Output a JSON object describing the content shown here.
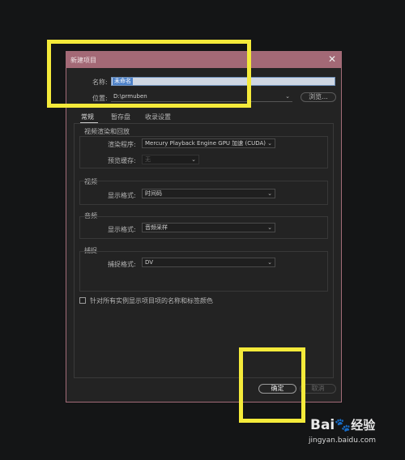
{
  "dialog": {
    "title": "新建项目",
    "close_glyph": "✕",
    "name_label": "名称:",
    "name_value": "未命名",
    "location_label": "位置:",
    "location_value": "D:\\prmuben",
    "browse_label": "浏览...",
    "tabs": [
      {
        "label": "常规",
        "active": true
      },
      {
        "label": "暂存盘",
        "active": false
      },
      {
        "label": "收录设置",
        "active": false
      }
    ],
    "video_rendering": {
      "heading": "视频渲染和回放",
      "renderer_label": "渲染程序:",
      "renderer_value": "Mercury Playback Engine GPU 加速 (CUDA)",
      "preview_cache_label": "预览缓存:",
      "preview_cache_value": "无"
    },
    "video": {
      "heading": "视频",
      "display_format_label": "显示格式:",
      "display_format_value": "时间码"
    },
    "audio": {
      "heading": "音频",
      "display_format_label": "显示格式:",
      "display_format_value": "音频采样"
    },
    "capture": {
      "heading": "捕捉",
      "capture_format_label": "捕捉格式:",
      "capture_format_value": "DV"
    },
    "checkbox_label": "针对所有实例显示项目项的名称和标签颜色",
    "ok_label": "确定",
    "cancel_label": "取消"
  },
  "watermark": {
    "brand": "Bai",
    "brand_suffix": "经验",
    "url": "jingyan.baidu.com"
  },
  "colors": {
    "title_bar": "#a36976",
    "highlight": "#f4ea3a",
    "background": "#141516"
  }
}
